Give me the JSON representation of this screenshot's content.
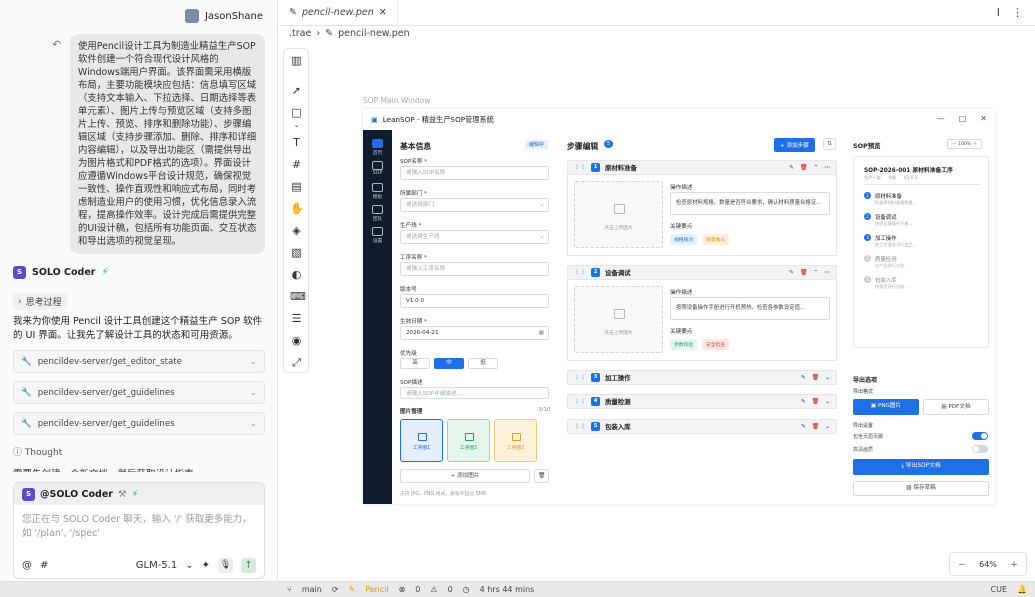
{
  "user": {
    "name": "JasonShane"
  },
  "prompt_text": "使用Pencil设计工具为制造业精益生产SOP软件创建一个符合现代设计风格的Windows端用户界面。该界面需采用横版布局，主要功能模块应包括：信息填写区域（支持文本输入、下拉选择、日期选择等表单元素）、图片上传与预览区域（支持多图片上传、预览、排序和删除功能）、步骤编辑区域（支持步骤添加、删除、排序和详细内容编辑），以及导出功能区（需提供导出为图片格式和PDF格式的选项）。界面设计应遵循Windows平台设计规范，确保视觉一致性、操作直观性和响应式布局，同时考虑制造业用户的使用习惯，优化信息录入流程，提高操作效率。设计完成后需提供完整的UI设计稿，包括所有功能页面、交互状态和导出选项的视觉呈现。",
  "assistant": {
    "name": "SOLO Coder",
    "thinking_label": "思考过程",
    "reply": "我来为你使用 Pencil 设计工具创建这个精益生产 SOP 软件的 UI 界面。让我先了解设计工具的状态和可用资源。",
    "tool_calls": [
      "pencildev-server/get_editor_state",
      "pencildev-server/get_guidelines",
      "pencildev-server/get_guidelines"
    ],
    "thought_label": "Thought",
    "cut_text": "需要先创建一个新文档，然后获取设计指南"
  },
  "composer": {
    "mention": "@SOLO Coder",
    "placeholder": "您正在与 SOLO Coder 聊天，输入 '/' 获取更多能力，如 '/plan', '/spec'",
    "model": "GLM-5.1"
  },
  "editor": {
    "tab_name": "pencil-new.pen",
    "breadcrumb": [
      ".trae",
      "pencil-new.pen"
    ],
    "canvas_frame_label": "SOP Main Window",
    "zoom": "64%"
  },
  "app": {
    "title": "LeanSOP - 精益生产SOP管理系统",
    "nav": [
      {
        "label": "首页"
      },
      {
        "label": "SOP"
      },
      {
        "label": "模板"
      },
      {
        "label": "团队"
      },
      {
        "label": "设置"
      }
    ],
    "basic_info": {
      "title": "基本信息",
      "badge": "编辑中",
      "fields": [
        {
          "label": "SOP名称 *",
          "value": "",
          "placeholder": "请输入SOP名称"
        },
        {
          "label": "所属部门 *",
          "value": "",
          "placeholder": "请选择部门"
        },
        {
          "label": "生产线 *",
          "value": "",
          "placeholder": "请选择生产线"
        },
        {
          "label": "工序名称 *",
          "value": "",
          "placeholder": "请输入工序名称"
        },
        {
          "label": "版本号",
          "value": "V1.0.0",
          "placeholder": ""
        },
        {
          "label": "生效日期 *",
          "value": "2026-04-21",
          "placeholder": ""
        }
      ],
      "priority_label": "优先级",
      "priority_options": [
        "高",
        "中",
        "低"
      ],
      "priority_selected": "中",
      "desc_label": "SOP描述",
      "desc_placeholder": "请输入SOP详细描述...",
      "image_manage_label": "图片管理",
      "image_count": "3/10",
      "images": [
        {
          "label": "工序图1",
          "color": "#1f6fe6",
          "bg": "#e6effd"
        },
        {
          "label": "工序图2",
          "color": "#22a45d",
          "bg": "#e5f6ec"
        },
        {
          "label": "工序图3",
          "color": "#e39b1b",
          "bg": "#fdf1dc"
        }
      ],
      "add_image": "+ 添加图片",
      "hint": "支持 JPG、PNG 格式，单张不超过 5MB"
    },
    "steps": {
      "title": "步骤编辑",
      "count": "5",
      "add_label": "+ 添加步骤",
      "items": [
        {
          "num": "1",
          "name": "原材料准备",
          "expanded": true,
          "upload": "点击上传图片",
          "op_label": "操作描述",
          "op_desc": "检查原材料规格、数量是否符合要求，确认材料质量合格证...",
          "kp_label": "关键要点",
          "kp": [
            {
              "t": "规格核对",
              "c": "#1f6fe6",
              "b": "#e6effd"
            },
            {
              "t": "质量确认",
              "c": "#e39b1b",
              "b": "#fdf1dc"
            }
          ]
        },
        {
          "num": "2",
          "name": "设备调试",
          "expanded": true,
          "upload": "点击上传图片",
          "op_label": "操作描述",
          "op_desc": "按照设备操作手册进行开机预热，检查各参数设定值...",
          "kp_label": "关键要点",
          "kp": [
            {
              "t": "参数校验",
              "c": "#22a45d",
              "b": "#e5f6ec"
            },
            {
              "t": "安全检查",
              "c": "#e04848",
              "b": "#fde6e6"
            }
          ]
        },
        {
          "num": "3",
          "name": "加工操作",
          "expanded": false
        },
        {
          "num": "4",
          "name": "质量检测",
          "expanded": false
        },
        {
          "num": "5",
          "name": "包装入库",
          "expanded": false
        }
      ]
    },
    "preview": {
      "title": "SOP预览",
      "zoom": "100%",
      "doc_title": "SOP-2026-001 原材料准备工序",
      "meta": [
        "生产一部",
        "A线",
        "V1.0.0"
      ],
      "steps": [
        {
          "n": "1",
          "t": "原材料准备",
          "s": "检查原材料规格数量...",
          "done": true
        },
        {
          "n": "2",
          "t": "设备调试",
          "s": "按照设备操作手册...",
          "done": true
        },
        {
          "n": "3",
          "t": "加工操作",
          "s": "按工艺要求进行加工...",
          "done": true
        },
        {
          "n": "4",
          "t": "质量检测",
          "s": "对产品进行全检...",
          "done": false
        },
        {
          "n": "5",
          "t": "包装入库",
          "s": "按规范进行包装...",
          "done": false
        }
      ],
      "export_title": "导出选项",
      "format_label": "导出格式",
      "formats": [
        "PNG图片",
        "PDF文档"
      ],
      "settings_label": "导出设置",
      "opt1": "包含页眉页脚",
      "opt2": "高清画质",
      "export_btn": "导出SOP文档",
      "save_btn": "保存草稿"
    }
  },
  "status": {
    "branch": "main",
    "mode": "Pencil",
    "errors": "0",
    "warnings": "0",
    "time": "4 hrs 44 mins",
    "right": "CUE"
  }
}
